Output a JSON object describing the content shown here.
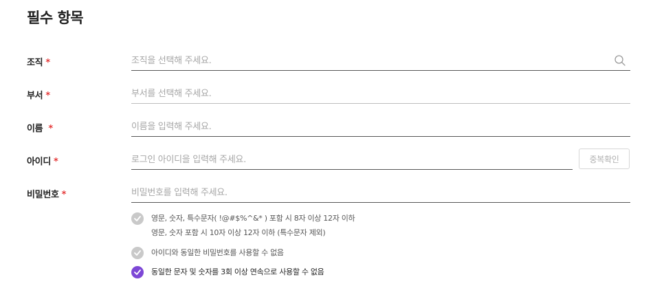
{
  "section_title": "필수 항목",
  "required_mark": "*",
  "fields": {
    "org": {
      "label": "조직",
      "placeholder": "조직을 선택해 주세요.",
      "value": ""
    },
    "dept": {
      "label": "부서",
      "placeholder": "부서를 선택해 주세요.",
      "value": ""
    },
    "name": {
      "label": "이름",
      "placeholder": "이름을 입력해 주세요.",
      "value": ""
    },
    "login_id": {
      "label": "아이디",
      "placeholder": "로그인 아이디을 입력해 주세요.",
      "value": "",
      "duplicate_check_label": "중복확인"
    },
    "password": {
      "label": "비밀번호",
      "placeholder": "비밀번호를 입력해 주세요.",
      "value": ""
    }
  },
  "password_rules": [
    {
      "line1": "영문, 숫자, 특수문자( !@#$%^&* ) 포함 시 8자 이상 12자 이하",
      "line2": "영문, 숫자 포함 시 10자 이상 12자 이하 (특수문자 제외)",
      "checked": false
    },
    {
      "line1": "아이디와 동일한 비밀번호를 사용할 수 없음",
      "checked": false
    },
    {
      "line1": "동일한 문자 및 숫자를 3회 이상 연속으로 사용할 수 없음",
      "checked": true
    }
  ],
  "colors": {
    "required": "#e53b3b",
    "check_active": "#7d47d6",
    "check_inactive": "#c9c9c9"
  },
  "icons": {
    "org_field": "search-icon",
    "rule_check": "check-circle-icon"
  }
}
